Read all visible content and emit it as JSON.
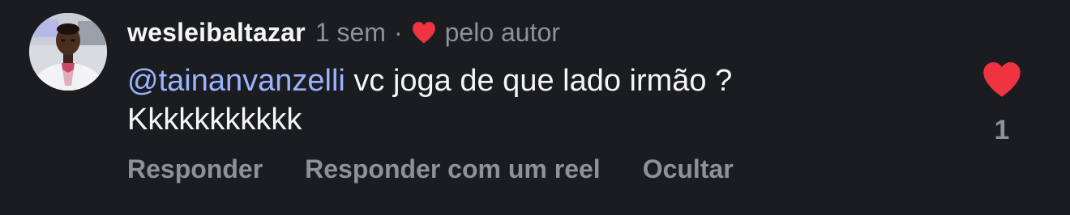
{
  "comment": {
    "username": "wesleibaltazar",
    "time_ago": "1 sem",
    "separator": "·",
    "liked_by_author_label": "pelo autor",
    "mention": "@tainanvanzelli",
    "text_line1": " vc joga de que lado irmão ?",
    "text_line2": "Kkkkkkkkkkk",
    "like_count": "1"
  },
  "actions": {
    "reply": "Responder",
    "reply_with_reel": "Responder com um reel",
    "hide": "Ocultar"
  },
  "colors": {
    "background": "#1a1c1f",
    "heart_red": "#ef3340",
    "mention_blue": "#9ab3ff",
    "muted_gray": "#8e9196"
  },
  "icons": {
    "author_heart": "heart-icon",
    "like": "heart-icon"
  }
}
